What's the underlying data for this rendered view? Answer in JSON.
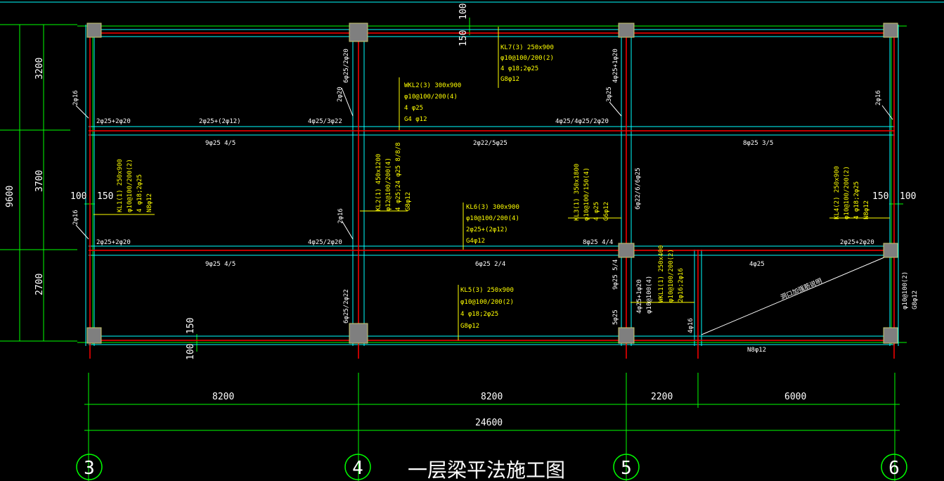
{
  "title": "一层梁平法施工图",
  "axes": [
    "3",
    "4",
    "5",
    "6"
  ],
  "dimensions": {
    "bottom": [
      "8200",
      "8200",
      "2200",
      "6000"
    ],
    "total": "24600",
    "left_total": "9600",
    "left": [
      "3200",
      "3700",
      "2700"
    ],
    "offsets": [
      "100",
      "150",
      "150",
      "100",
      "100",
      "150",
      "150",
      "100"
    ]
  },
  "beams": {
    "kl7": [
      "KL7(3) 250x900",
      "φ10@100/200(2)",
      "4 φ18;2φ25",
      "G8φ12"
    ],
    "wkl2": [
      "WKL2(3) 300x900",
      "φ10@100/200(4)",
      "4 φ25",
      "G4 φ12"
    ],
    "kl6": [
      "KL6(3) 300x900",
      "φ10@100/200(4)",
      "2φ25+(2φ12)",
      "G4φ12"
    ],
    "kl5": [
      "KL5(3) 250x900",
      "φ10@100/200(2)",
      "4 φ18;2φ25",
      "G8φ12"
    ],
    "kl1": [
      "KL1(1) 250x900",
      "φ10@100/200(2)",
      "4 φ18;2φ25",
      "N8φ12"
    ],
    "kl2": [
      "KL2(1) 450x1200",
      "φ12@100/200(4)",
      "4 φ25;24 φ25 8/8/8",
      "G8φ12"
    ],
    "kl3": [
      "KL3(1) 350x1800",
      "φ10@100/150(4)",
      "4 φ25",
      "G6φ12"
    ],
    "kl4": [
      "KL4(2) 250x900",
      "φ10@100/200(2)",
      "4 φ18;2φ25",
      "N8φ12"
    ],
    "wkl1": [
      "WKL1(1) 250x400",
      "φ10@100/200(2)",
      "2φ16;2φ16"
    ]
  },
  "rebar": {
    "r1": "2φ25+2φ20",
    "r2": "2φ25+(2φ12)",
    "r3": "4φ25/3φ22",
    "r4": "4φ25/4φ25/2φ20",
    "r5": "9φ25 4/5",
    "r6": "2φ22/5φ25",
    "r7": "8φ25 3/5",
    "r8": "2φ25+2φ20",
    "r9": "4φ25/2φ20",
    "r10": "8φ25 4/4",
    "r11": "2φ25+2φ20",
    "r12": "9φ25 4/5",
    "r13": "6φ25 2/4",
    "r14": "4φ25",
    "r15": "N8φ12",
    "v1": "2φ16",
    "v2": "2φ16",
    "v3": "6φ25/2φ20",
    "v4": "2φ20",
    "v5": "4φ25+1φ20",
    "v6": "3φ25",
    "v7": "2φ16",
    "v8": "2φ16",
    "v9": "6φ22/6/6φ25",
    "v10": "6φ25/2φ22",
    "v11": "9φ25 5/4",
    "v12": "5φ25",
    "v13": "4φ25+1φ20",
    "v14": "φ10@100(4)",
    "v15": "4φ16",
    "v16": "φ10@100(2)",
    "v17": "G8φ12",
    "diag": "洞口加强筋说明"
  },
  "colors": {
    "background": "#000000",
    "beam_outline": "#00ffff",
    "beam_axis": "#ff0000",
    "grid_line": "#00ff00",
    "annotation": "#ffff00",
    "text": "#ffffff",
    "column": "#808080"
  }
}
